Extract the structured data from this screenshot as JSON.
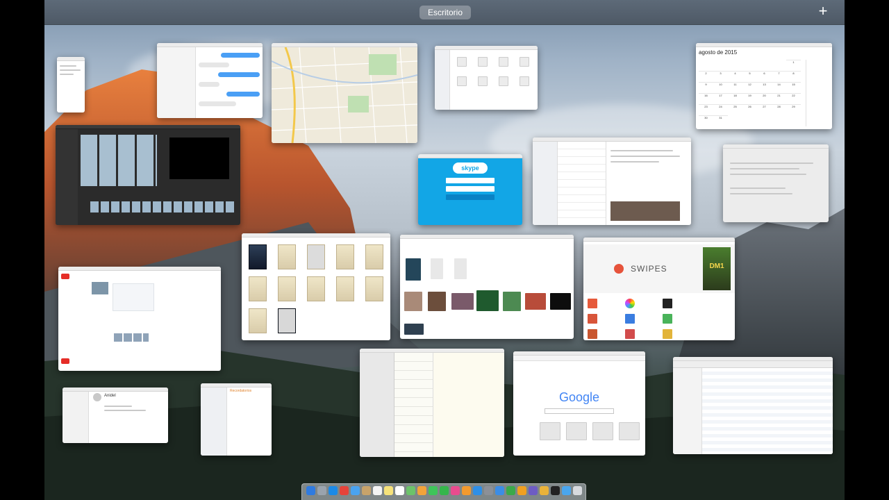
{
  "spaces_bar": {
    "desktop_label": "Escritorio",
    "add_label": "+"
  },
  "calendar": {
    "month_title": "agosto de 2015",
    "days": [
      "1",
      "2",
      "3",
      "4",
      "5",
      "6",
      "7",
      "8",
      "9",
      "10",
      "11",
      "12",
      "13",
      "14",
      "15",
      "16",
      "17",
      "18",
      "19",
      "20",
      "21",
      "22",
      "23",
      "24",
      "25",
      "26",
      "27",
      "28",
      "29",
      "30",
      "31"
    ]
  },
  "skype": {
    "logo_text": "skype"
  },
  "swipes": {
    "brand": "SWIPES",
    "game_badge": "DM1"
  },
  "google": {
    "logo_text": "Google"
  },
  "notes": {
    "title": "Recordatorios"
  },
  "contacts": {
    "name": "Anidel"
  },
  "windows": [
    "mini-window",
    "messages",
    "maps",
    "finder",
    "calendar",
    "imovie",
    "skype",
    "mail",
    "system-preferences",
    "safari-youtube",
    "ibooks",
    "photos",
    "app-store",
    "contacts",
    "reminders",
    "notes",
    "safari-google",
    "itunes"
  ],
  "dock": {
    "icons": [
      {
        "name": "finder-icon",
        "color": "#2f7be0"
      },
      {
        "name": "launchpad-icon",
        "color": "#9aa3ad"
      },
      {
        "name": "safari-icon",
        "color": "#1c8ae6"
      },
      {
        "name": "chrome-icon",
        "color": "#e5433a"
      },
      {
        "name": "mail-icon",
        "color": "#4aa3f0"
      },
      {
        "name": "contacts-icon",
        "color": "#c8a36a"
      },
      {
        "name": "calendar-icon",
        "color": "#f4f4f4"
      },
      {
        "name": "notes-icon",
        "color": "#f6e27a"
      },
      {
        "name": "reminders-icon",
        "color": "#ffffff"
      },
      {
        "name": "maps-icon",
        "color": "#6cc36a"
      },
      {
        "name": "photos-icon",
        "color": "#f2a33a"
      },
      {
        "name": "messages-icon",
        "color": "#3fc55a"
      },
      {
        "name": "facetime-icon",
        "color": "#35b64b"
      },
      {
        "name": "itunes-icon",
        "color": "#e94b8e"
      },
      {
        "name": "ibooks-icon",
        "color": "#f29a2e"
      },
      {
        "name": "app-store-icon",
        "color": "#2e8fe6"
      },
      {
        "name": "system-preferences-icon",
        "color": "#8c9097"
      },
      {
        "name": "keynote-icon",
        "color": "#3b8de6"
      },
      {
        "name": "numbers-icon",
        "color": "#3aa94a"
      },
      {
        "name": "pages-icon",
        "color": "#f0a020"
      },
      {
        "name": "imovie-icon",
        "color": "#6d5cc4"
      },
      {
        "name": "chrome-canary-icon",
        "color": "#e9b23a"
      },
      {
        "name": "game-icon",
        "color": "#222222"
      },
      {
        "name": "downloads-folder-icon",
        "color": "#4aa6ee"
      },
      {
        "name": "trash-icon",
        "color": "#d7dade"
      }
    ]
  }
}
